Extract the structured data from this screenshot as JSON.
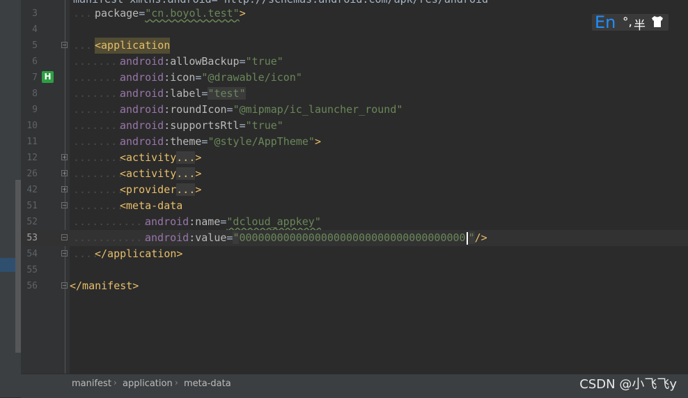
{
  "top_cut_line": {
    "text": "manifest xmlns:android=\"http://schemas.android.com/apk/res/android\""
  },
  "lines": [
    {
      "num": "3",
      "package_attr": "package",
      "package_value": "\"cn.boyol.test\""
    },
    {
      "num": "4"
    },
    {
      "num": "5",
      "tag": "<application"
    },
    {
      "num": "6",
      "ns": "android",
      "attr": ":allowBackup",
      "eq": "=",
      "value": "\"true\""
    },
    {
      "num": "7",
      "ns": "android",
      "attr": ":icon",
      "eq": "=",
      "value": "\"@drawable/icon\"",
      "gutter_icon": "H"
    },
    {
      "num": "8",
      "ns": "android",
      "attr": ":label",
      "eq": "=",
      "value": "\"test\""
    },
    {
      "num": "9",
      "ns": "android",
      "attr": ":roundIcon",
      "eq": "=",
      "value": "\"@mipmap/ic_launcher_round\""
    },
    {
      "num": "10",
      "ns": "android",
      "attr": ":supportsRtl",
      "eq": "=",
      "value": "\"true\""
    },
    {
      "num": "11",
      "ns": "android",
      "attr": ":theme",
      "eq": "=",
      "value": "\"@style/AppTheme\"",
      "close": ">"
    },
    {
      "num": "12",
      "tag": "<activity",
      "folded": "...",
      "close": ">"
    },
    {
      "num": "26",
      "tag": "<activity",
      "folded": "...",
      "close": ">"
    },
    {
      "num": "42",
      "tag": "<provider",
      "folded": "...",
      "close": ">"
    },
    {
      "num": "51",
      "tag": "<meta-data"
    },
    {
      "num": "52",
      "ns": "android",
      "attr": ":name",
      "eq": "=",
      "value": "\"dcloud_appkey\""
    },
    {
      "num": "53",
      "ns": "android",
      "attr": ":value",
      "eq": "=",
      "value_open": "\"",
      "value": "000000000000000000000000000000000000",
      "value_close": "\"",
      "close": "/>"
    },
    {
      "num": "54",
      "tag": "</application>"
    },
    {
      "num": "55"
    },
    {
      "num": "56",
      "tag": "</manifest>"
    }
  ],
  "ime": {
    "lang": "En",
    "punct": "°,",
    "width_mode": "半",
    "skin_icon": "shirt-icon"
  },
  "breadcrumb": [
    "manifest",
    "application",
    "meta-data"
  ],
  "watermark": "CSDN @小飞飞y",
  "colors": {
    "tag": "#e8bf6a",
    "namespace": "#9876aa",
    "value": "#6a8759",
    "background": "#2b2b2b"
  }
}
